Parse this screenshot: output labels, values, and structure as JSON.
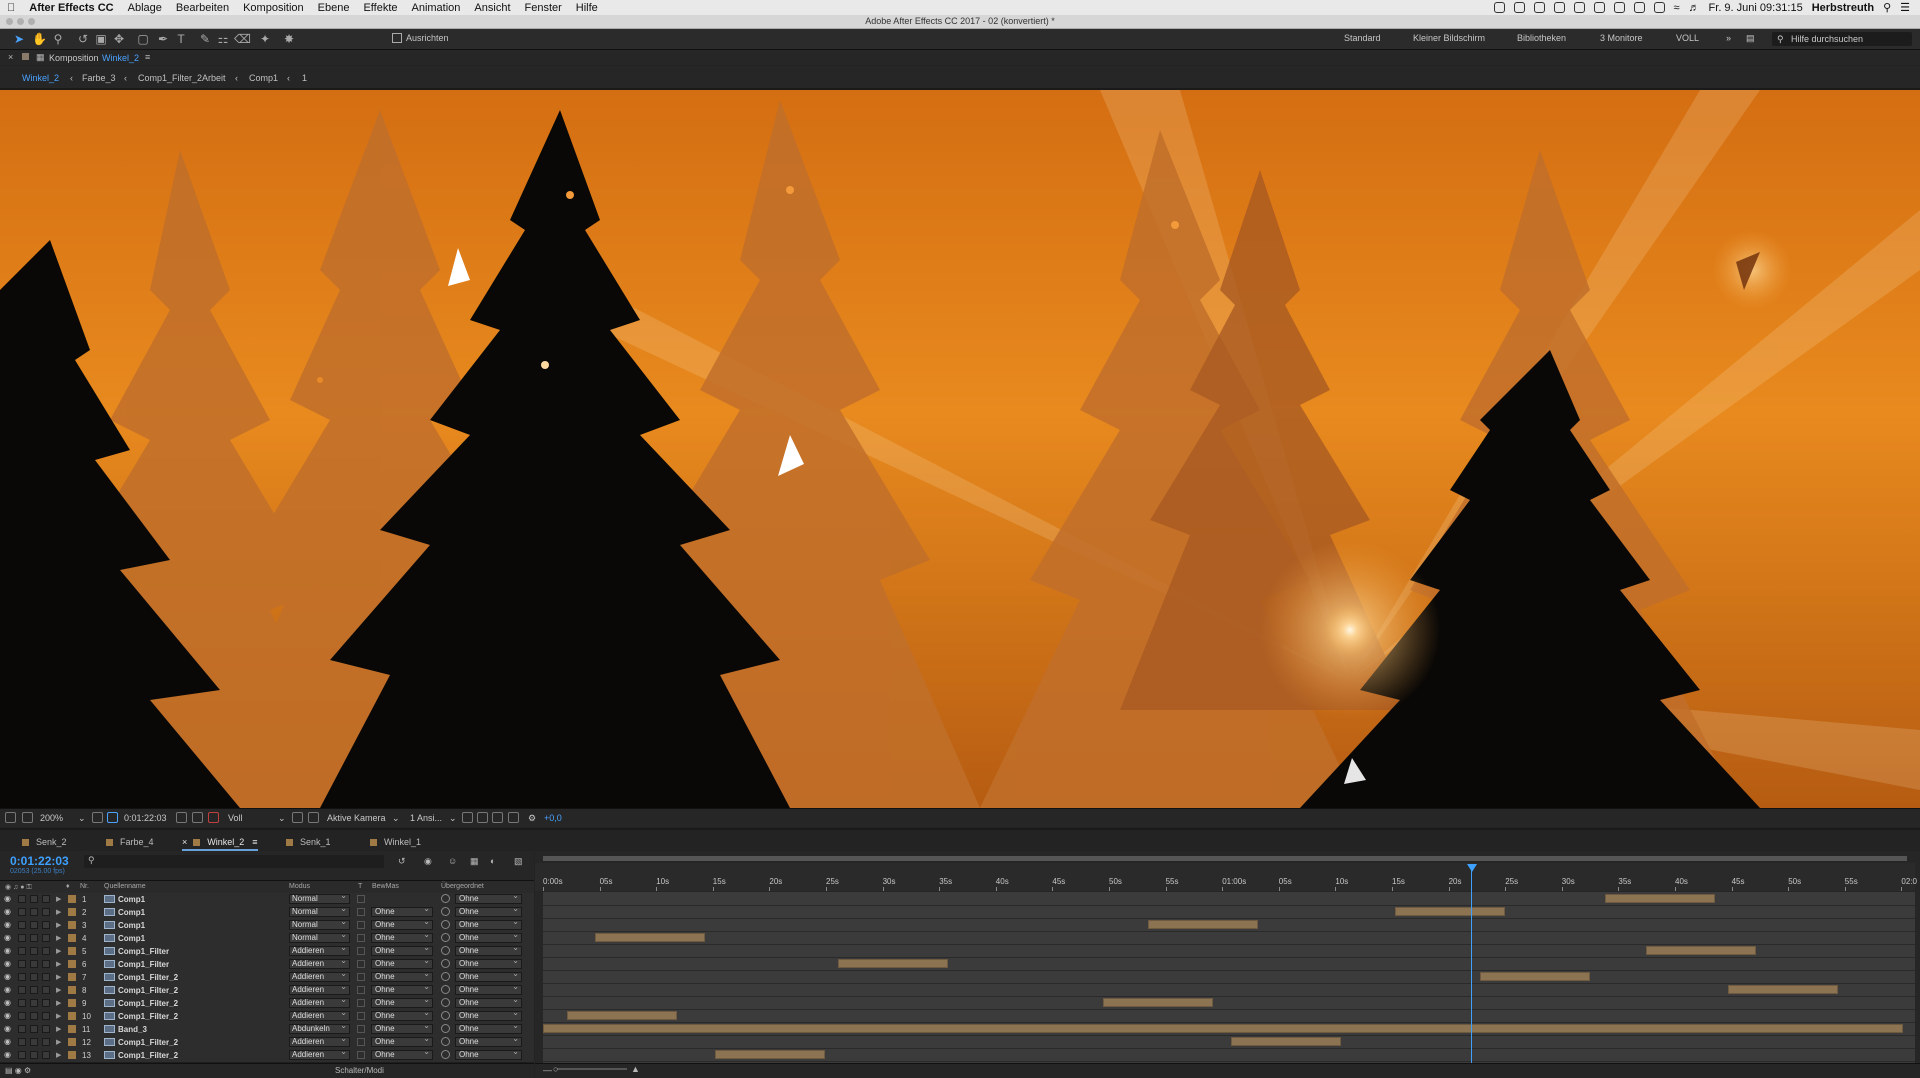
{
  "menubar": {
    "app_name": "After Effects CC",
    "items": [
      "Ablage",
      "Bearbeiten",
      "Komposition",
      "Ebene",
      "Effekte",
      "Animation",
      "Ansicht",
      "Fenster",
      "Hilfe"
    ],
    "datetime": "Fr. 9. Juni  09:31:15",
    "user": "Herbstreuth"
  },
  "window": {
    "title": "Adobe After Effects CC 2017 - 02 (konvertiert) *"
  },
  "toolbar": {
    "align_label": "Ausrichten",
    "workspaces": [
      "Standard",
      "Kleiner Bildschirm",
      "Bibliotheken",
      "3 Monitore",
      "VOLL"
    ],
    "search_placeholder": "Hilfe durchsuchen"
  },
  "composition": {
    "panel_label": "Komposition",
    "panel_name": "Winkel_2",
    "breadcrumb": [
      "Winkel_2",
      "Farbe_3",
      "Comp1_Filter_2Arbeit",
      "Comp1",
      "1"
    ]
  },
  "viewer_footer": {
    "zoom": "200%",
    "timecode": "0:01:22:03",
    "resolution": "Voll",
    "camera": "Aktive Kamera",
    "views": "1 Ansi...",
    "exposure": "+0,0"
  },
  "timeline": {
    "tabs": [
      "Senk_2",
      "Farbe_4",
      "Winkel_2",
      "Senk_1",
      "Winkel_1"
    ],
    "active_tab": "Winkel_2",
    "timecode": "0:01:22:03",
    "timecode_sub": "02053 (25.00 fps)",
    "columns": {
      "nr": "Nr.",
      "source": "Quellenname",
      "mode": "Modus",
      "t": "T",
      "trkmat": "BewMas",
      "parent": "Übergeordnet"
    },
    "footer_label": "Schalter/Modi",
    "ruler": [
      "0:00s",
      "05s",
      "10s",
      "15s",
      "20s",
      "25s",
      "30s",
      "35s",
      "40s",
      "45s",
      "50s",
      "55s",
      "01:00s",
      "05s",
      "10s",
      "15s",
      "20s",
      "25s",
      "30s",
      "35s",
      "40s",
      "45s",
      "50s",
      "55s",
      "02:0"
    ],
    "layers": [
      {
        "nr": "1",
        "name": "Comp1",
        "mode": "Normal",
        "trkmat": "",
        "parent": "Ohne"
      },
      {
        "nr": "2",
        "name": "Comp1",
        "mode": "Normal",
        "trkmat": "Ohne",
        "parent": "Ohne"
      },
      {
        "nr": "3",
        "name": "Comp1",
        "mode": "Normal",
        "trkmat": "Ohne",
        "parent": "Ohne"
      },
      {
        "nr": "4",
        "name": "Comp1",
        "mode": "Normal",
        "trkmat": "Ohne",
        "parent": "Ohne"
      },
      {
        "nr": "5",
        "name": "Comp1_Filter",
        "mode": "Addieren",
        "trkmat": "Ohne",
        "parent": "Ohne"
      },
      {
        "nr": "6",
        "name": "Comp1_Filter",
        "mode": "Addieren",
        "trkmat": "Ohne",
        "parent": "Ohne"
      },
      {
        "nr": "7",
        "name": "Comp1_Filter_2",
        "mode": "Addieren",
        "trkmat": "Ohne",
        "parent": "Ohne"
      },
      {
        "nr": "8",
        "name": "Comp1_Filter_2",
        "mode": "Addieren",
        "trkmat": "Ohne",
        "parent": "Ohne"
      },
      {
        "nr": "9",
        "name": "Comp1_Filter_2",
        "mode": "Addieren",
        "trkmat": "Ohne",
        "parent": "Ohne"
      },
      {
        "nr": "10",
        "name": "Comp1_Filter_2",
        "mode": "Addieren",
        "trkmat": "Ohne",
        "parent": "Ohne"
      },
      {
        "nr": "11",
        "name": "Band_3",
        "mode": "Abdunkeln",
        "trkmat": "Ohne",
        "parent": "Ohne"
      },
      {
        "nr": "12",
        "name": "Comp1_Filter_2",
        "mode": "Addieren",
        "trkmat": "Ohne",
        "parent": "Ohne"
      },
      {
        "nr": "13",
        "name": "Comp1_Filter_2",
        "mode": "Addieren",
        "trkmat": "Ohne",
        "parent": "Ohne"
      }
    ]
  }
}
